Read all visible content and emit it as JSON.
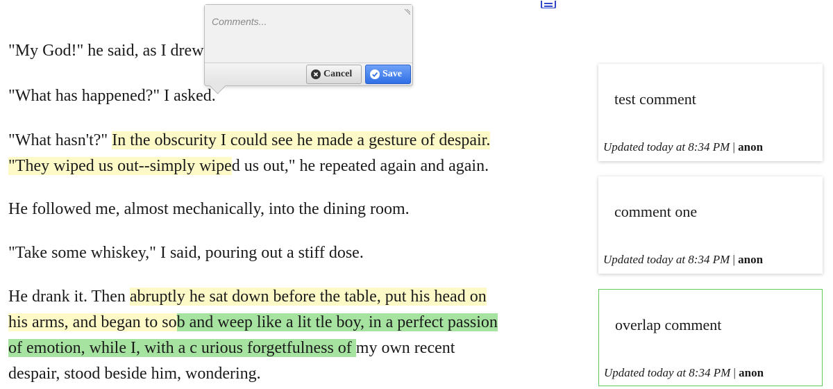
{
  "document": {
    "paragraphs": [
      {
        "segments": [
          {
            "text": "\"My God!\" he said, as I drew him in.",
            "hl": ""
          }
        ]
      },
      {
        "segments": [
          {
            "text": "\"What has happened?\" I asked.",
            "hl": ""
          }
        ]
      },
      {
        "segments": [
          {
            "text": "\"What hasn't?\" ",
            "hl": ""
          },
          {
            "text": "In the obscurity I could see he made a gesture of despair.",
            "hl": "y",
            "br": true
          },
          {
            "text": "\"They wiped us out--simply wipe",
            "hl": "y"
          },
          {
            "text": "d us out,\" he repeated again and again.",
            "hl": ""
          }
        ]
      },
      {
        "segments": [
          {
            "text": "He followed me, almost mechanically, into the dining room.",
            "hl": ""
          }
        ]
      },
      {
        "segments": [
          {
            "text": "\"Take some whiskey,\" I said, pouring out a stiff dose.",
            "hl": ""
          }
        ]
      },
      {
        "segments": [
          {
            "text": "He drank it. Then ",
            "hl": ""
          },
          {
            "text": "abruptly he sat down before the table, put his head on",
            "hl": "y",
            "br": true
          },
          {
            "text": "his arms, and began to so",
            "hl": "y"
          },
          {
            "text": "b and weep like a lit  tle boy, in a perfect passion",
            "hl": "g",
            "br": true
          },
          {
            "text": "of emotion, while I, with a c  urious forgetfulness of ",
            "hl": "g"
          },
          {
            "text": " my own recent",
            "hl": "",
            "br": true
          },
          {
            "text": "despair, stood beside him, wondering.",
            "hl": ""
          }
        ]
      }
    ]
  },
  "comment_editor": {
    "placeholder": "Comments...",
    "cancel_label": "Cancel",
    "save_label": "Save"
  },
  "comments": [
    {
      "text": "test comment",
      "updated": "Updated today at 8:34 PM",
      "separator": "|",
      "author": "anon",
      "active": false
    },
    {
      "text": "comment one",
      "updated": "Updated today at 8:34 PM",
      "separator": "|",
      "author": "anon",
      "active": false
    },
    {
      "text": "overlap comment",
      "updated": "Updated today at 8:34 PM",
      "separator": "|",
      "author": "anon",
      "active": true
    }
  ],
  "colors": {
    "highlight_yellow": "#fdfac8",
    "highlight_green": "#a6e2a0",
    "save_blue": "#2f6fe6",
    "active_border": "#5fc95a"
  },
  "icons": {
    "toolbar": "document-icon",
    "cancel": "close-circle-icon",
    "save": "check-circle-icon"
  }
}
